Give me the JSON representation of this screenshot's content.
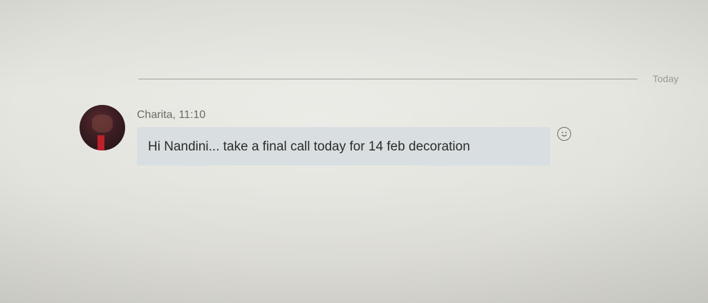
{
  "divider": {
    "label": "Today"
  },
  "message": {
    "sender_meta": "Charita, 11:10",
    "text": "Hi Nandini... take a final call today  for 14 feb decoration"
  },
  "icons": {
    "reaction": "smiley-icon",
    "avatar": "user-avatar"
  },
  "colors": {
    "bubble": "#d9dfe1",
    "text": "#2b2b2b",
    "meta": "#6b6b66"
  }
}
